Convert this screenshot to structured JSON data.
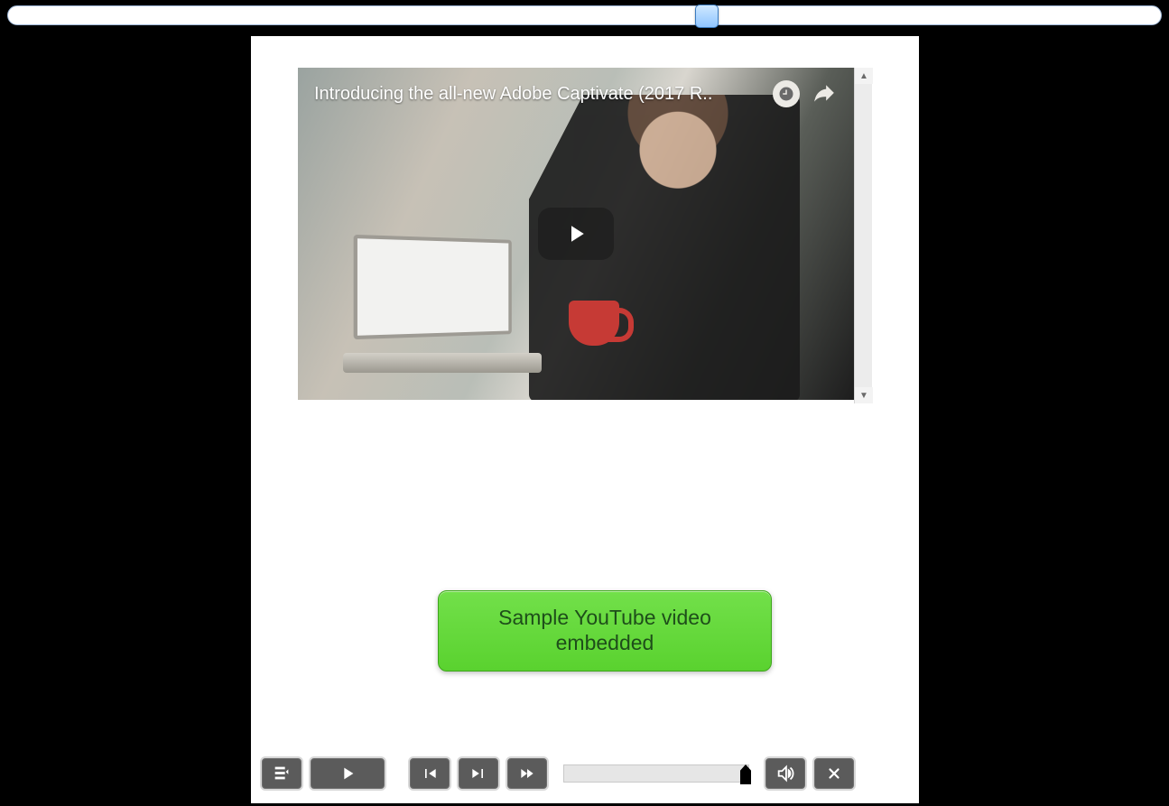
{
  "top_slider": {
    "percent": 59.6
  },
  "video": {
    "title": "Introducing the all-new Adobe Captivate (2017 R..",
    "watch_later_icon": "watch-later",
    "share_icon": "share"
  },
  "callout": {
    "text": "Sample YouTube video embedded"
  },
  "playbar": {
    "progress_percent": 100,
    "buttons": {
      "toc": "toc",
      "play": "play",
      "prev": "previous",
      "next": "next",
      "ff": "fast-forward",
      "audio": "audio",
      "close": "close"
    }
  }
}
